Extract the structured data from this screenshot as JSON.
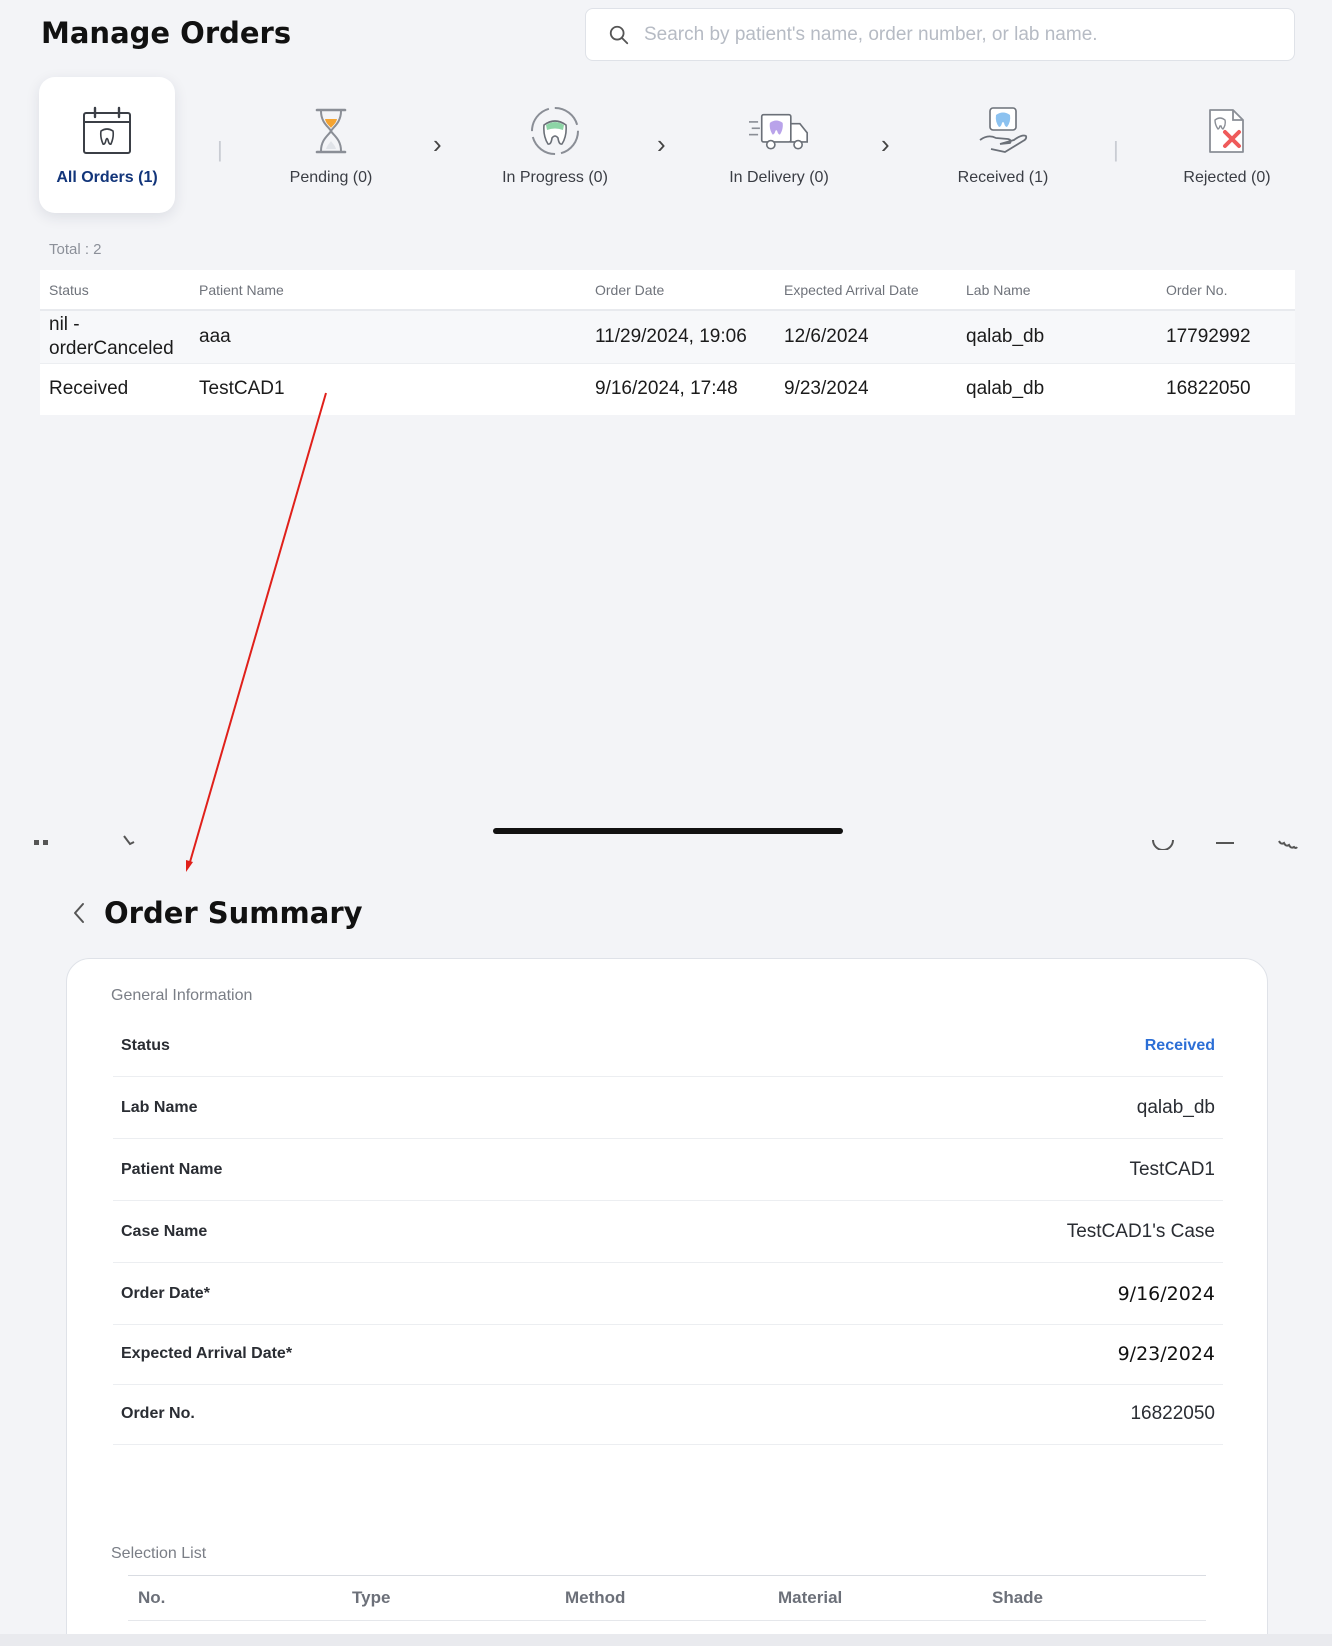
{
  "header": {
    "title": "Manage Orders",
    "search_placeholder": "Search by patient's name, order number, or lab name."
  },
  "steps": [
    {
      "label": "All Orders (1)",
      "icon": "calendar-tooth-icon",
      "active": true
    },
    {
      "label": "Pending (0)",
      "icon": "hourglass-icon"
    },
    {
      "label": "In Progress (0)",
      "icon": "tooth-cycle-icon"
    },
    {
      "label": "In Delivery (0)",
      "icon": "delivery-truck-icon"
    },
    {
      "label": "Received (1)",
      "icon": "hand-tooth-icon"
    },
    {
      "label": "Rejected (0)",
      "icon": "rejected-document-icon"
    }
  ],
  "orders": {
    "total_label": "Total : 2",
    "columns": [
      "Status",
      "Patient Name",
      "Order Date",
      "Expected Arrival Date",
      "Lab Name",
      "Order No."
    ],
    "rows": [
      {
        "status": "nil - orderCanceled",
        "patient": "aaa",
        "order_date": "11/29/2024, 19:06",
        "arrival": "12/6/2024",
        "lab": "qalab_db",
        "order_no": "17792992"
      },
      {
        "status": "Received",
        "patient": "TestCAD1",
        "order_date": "9/16/2024, 17:48",
        "arrival": "9/23/2024",
        "lab": "qalab_db",
        "order_no": "16822050"
      }
    ]
  },
  "summary": {
    "title": "Order Summary",
    "general_label": "General Information",
    "rows": [
      {
        "key": "Status",
        "value": "Received"
      },
      {
        "key": "Lab Name",
        "value": "qalab_db"
      },
      {
        "key": "Patient Name",
        "value": "TestCAD1"
      },
      {
        "key": "Case Name",
        "value": "TestCAD1's Case"
      },
      {
        "key": "Order Date*",
        "value": "9/16/2024"
      },
      {
        "key": "Expected Arrival Date*",
        "value": "9/23/2024"
      },
      {
        "key": "Order No.",
        "value": "16822050"
      }
    ],
    "selection_label": "Selection List",
    "selection_columns": [
      "No.",
      "Type",
      "Method",
      "Material",
      "Shade"
    ]
  },
  "colors": {
    "accent": "#12357a",
    "status_received": "#2c6fd6",
    "annotation_arrow": "#e0201b"
  }
}
